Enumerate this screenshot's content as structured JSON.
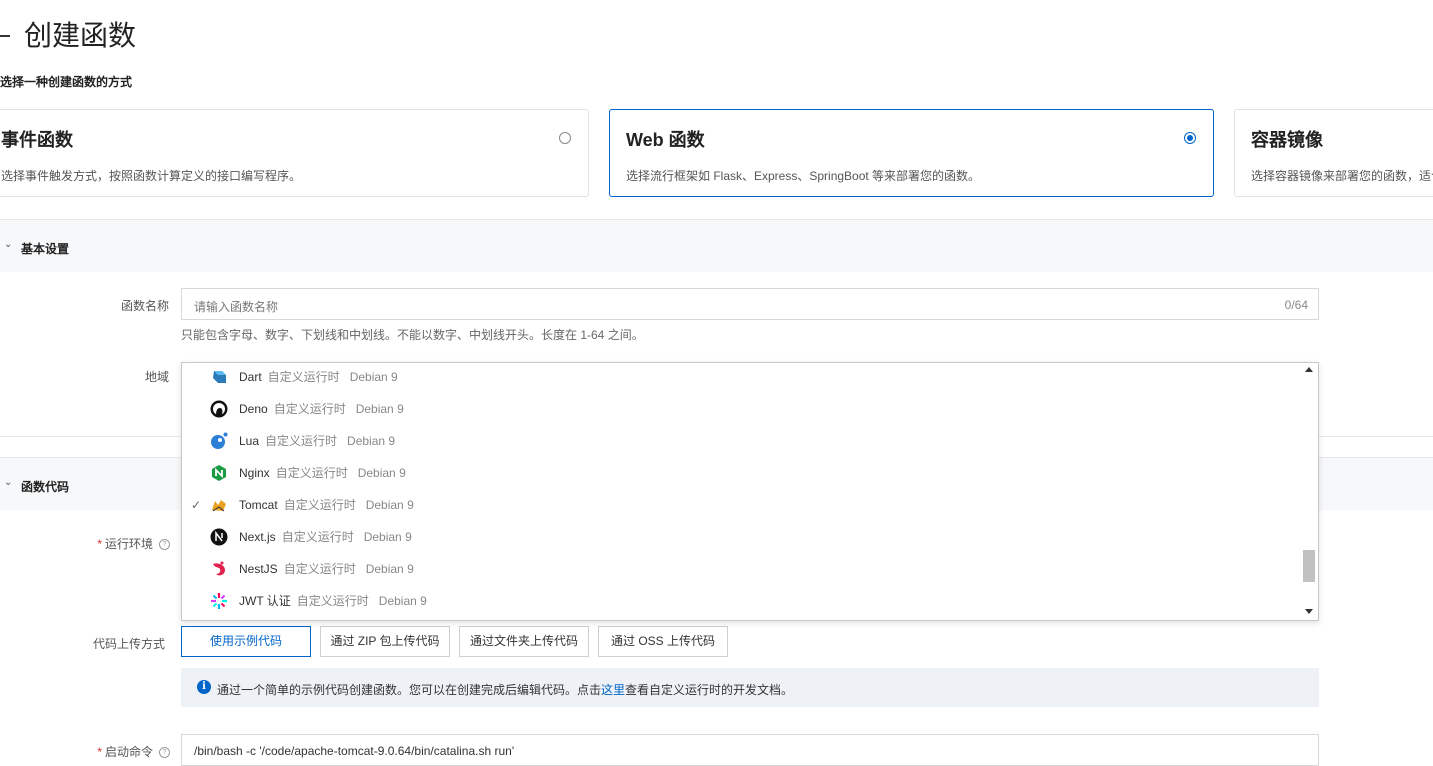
{
  "page": {
    "title": "创建函数",
    "subtitle": "选择一种创建函数的方式"
  },
  "cards": [
    {
      "title": "事件函数",
      "desc": "选择事件触发方式，按照函数计算定义的接口编写程序。",
      "selected": false
    },
    {
      "title": "Web 函数",
      "desc": "选择流行框架如 Flask、Express、SpringBoot 等来部署您的函数。",
      "selected": true
    },
    {
      "title": "容器镜像",
      "desc": "选择容器镜像来部署您的函数，适合",
      "selected": false
    }
  ],
  "basic": {
    "section_label": "基本设置",
    "name_label": "函数名称",
    "name_placeholder": "请输入函数名称",
    "name_counter": "0/64",
    "name_hint": "只能包含字母、数字、下划线和中划线。不能以数字、中划线开头。长度在 1-64 之间。",
    "region_label": "地域"
  },
  "code": {
    "section_label": "函数代码",
    "runtime_label": "运行环境",
    "upload_label": "代码上传方式",
    "upload_buttons": [
      "使用示例代码",
      "通过 ZIP 包上传代码",
      "通过文件夹上传代码",
      "通过 OSS 上传代码"
    ],
    "notice_pre": "通过一个简单的示例代码创建函数。您可以在创建完成后编辑代码。点击",
    "notice_link": "这里",
    "notice_post": "查看自定义运行时的开发文档。",
    "cmd_label": "启动命令",
    "cmd_value": "/bin/bash -c '/code/apache-tomcat-9.0.64/bin/catalina.sh run'"
  },
  "runtime_options": [
    {
      "name": "Dart",
      "type": "自定义运行时",
      "os": "Debian 9",
      "icon": "dart-icon",
      "checked": false
    },
    {
      "name": "Deno",
      "type": "自定义运行时",
      "os": "Debian 9",
      "icon": "deno-icon",
      "checked": false
    },
    {
      "name": "Lua",
      "type": "自定义运行时",
      "os": "Debian 9",
      "icon": "lua-icon",
      "checked": false
    },
    {
      "name": "Nginx",
      "type": "自定义运行时",
      "os": "Debian 9",
      "icon": "nginx-icon",
      "checked": false
    },
    {
      "name": "Tomcat",
      "type": "自定义运行时",
      "os": "Debian 9",
      "icon": "tomcat-icon",
      "checked": true
    },
    {
      "name": "Next.js",
      "type": "自定义运行时",
      "os": "Debian 9",
      "icon": "nextjs-icon",
      "checked": false
    },
    {
      "name": "NestJS",
      "type": "自定义运行时",
      "os": "Debian 9",
      "icon": "nestjs-icon",
      "checked": false
    },
    {
      "name": "JWT 认证",
      "type": "自定义运行时",
      "os": "Debian 9",
      "icon": "jwt-icon",
      "checked": false
    }
  ],
  "colors": {
    "accent": "#0064c8",
    "band": "#f7f8fa",
    "required": "#d93026"
  }
}
